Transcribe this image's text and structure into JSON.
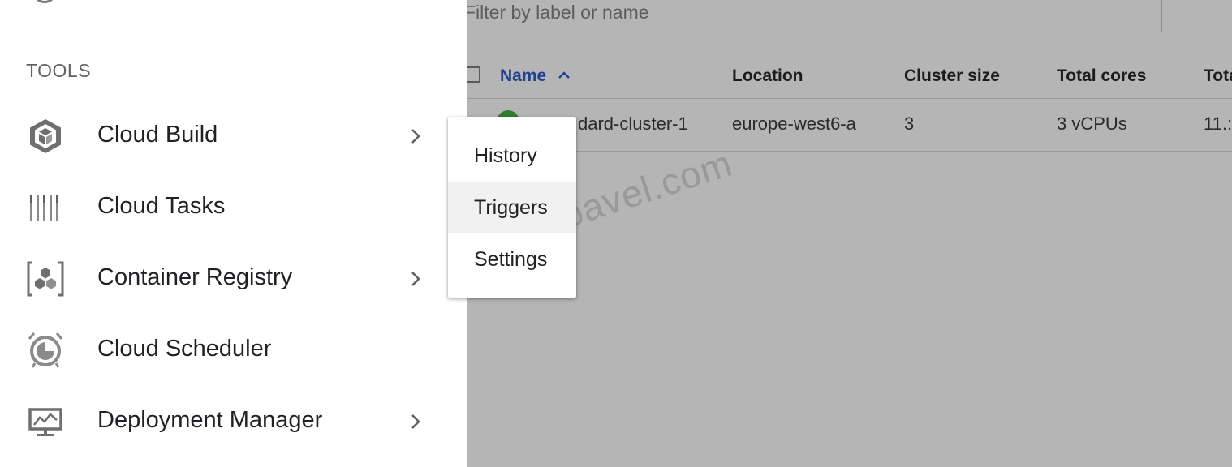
{
  "filter": {
    "placeholder": "Filter by label or name"
  },
  "table": {
    "columns": [
      "Name",
      "Location",
      "Cluster size",
      "Total cores",
      "Tota"
    ],
    "rows": [
      {
        "name": "dard-cluster-1",
        "location": "europe-west6-a",
        "size": "3",
        "cores": "3 vCPUs",
        "memory": "11.:"
      }
    ]
  },
  "watermark": "blogpavel.com",
  "drawer": {
    "section_title": "TOOLS",
    "items": [
      {
        "label": "Cloud Build",
        "icon": "cloud-build-icon",
        "has_submenu": true
      },
      {
        "label": "Cloud Tasks",
        "icon": "cloud-tasks-icon",
        "has_submenu": false
      },
      {
        "label": "Container Registry",
        "icon": "container-registry-icon",
        "has_submenu": true
      },
      {
        "label": "Cloud Scheduler",
        "icon": "cloud-scheduler-icon",
        "has_submenu": false
      },
      {
        "label": "Deployment Manager",
        "icon": "deployment-manager-icon",
        "has_submenu": true
      }
    ]
  },
  "flyout": {
    "items": [
      {
        "label": "History"
      },
      {
        "label": "Triggers",
        "hovered": true
      },
      {
        "label": "Settings"
      }
    ]
  },
  "colors": {
    "accent": "#1f3f8f",
    "status_ok": "#2e7d32",
    "icon_gray": "#757575"
  }
}
